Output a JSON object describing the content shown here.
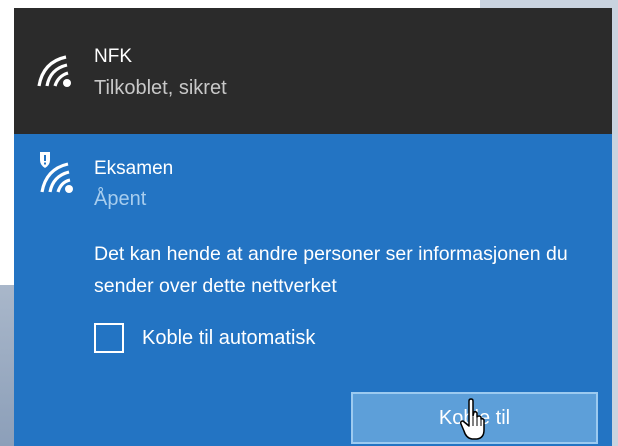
{
  "connected_network": {
    "name": "NFK",
    "status": "Tilkoblet, sikret",
    "icon": "wifi-icon"
  },
  "selected_network": {
    "name": "Eksamen",
    "status": "Åpent",
    "icon": "wifi-warning-icon",
    "warning": "Det kan hende at andre personer ser informasjonen du sender over dette nettverket",
    "auto_connect_label": "Koble til automatisk",
    "auto_connect_checked": false,
    "connect_button": "Koble til"
  },
  "colors": {
    "connected_bg": "#2b2b2b",
    "selected_bg": "#2374c3",
    "button_bg": "#5d9fd9",
    "status_dim": "#c8c8c8",
    "status_light": "#a7cdee"
  }
}
